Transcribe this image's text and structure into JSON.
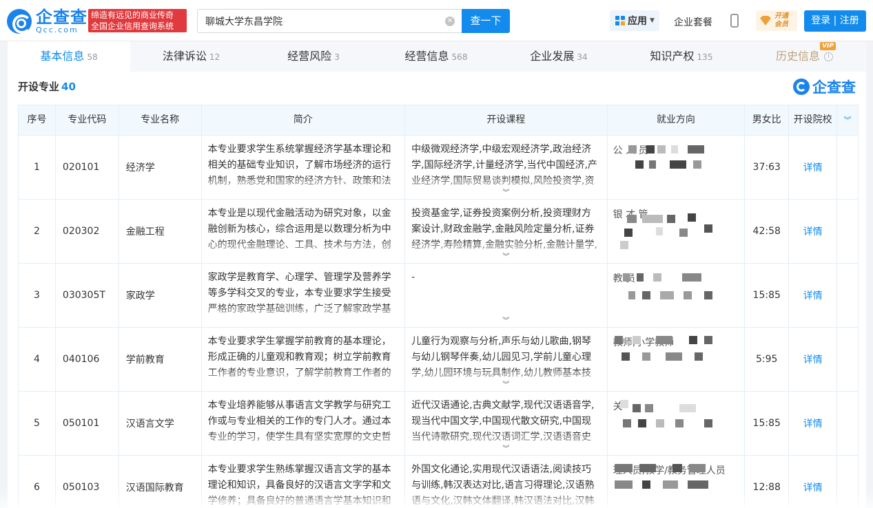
{
  "header": {
    "logo_cn": "企查查",
    "logo_en": "Qcc.com",
    "slogan_line1": "缔造有远见的商业传奇",
    "slogan_line2": "全国企业信用查询系统",
    "search_value": "聊城大学东昌学院",
    "search_button": "查一下",
    "app_label": "应用",
    "suite_label": "企业套餐",
    "vip_line1": "开通",
    "vip_line2": "会员",
    "login_label": "登录 | 注册"
  },
  "tabs": [
    {
      "label": "基本信息",
      "count": "58"
    },
    {
      "label": "法律诉讼",
      "count": "12"
    },
    {
      "label": "经营风险",
      "count": "3"
    },
    {
      "label": "经营信息",
      "count": "568"
    },
    {
      "label": "企业发展",
      "count": "34"
    },
    {
      "label": "知识产权",
      "count": "135"
    },
    {
      "label": "历史信息",
      "count": "",
      "vip": "VIP"
    }
  ],
  "section": {
    "title": "开设专业",
    "count": "40"
  },
  "watermark": "企查查",
  "table": {
    "headers": [
      "序号",
      "专业代码",
      "专业名称",
      "简介",
      "开设课程",
      "就业方向",
      "男女比",
      "开设院校"
    ],
    "rows": [
      {
        "index": "1",
        "code": "020101",
        "name": "经济学",
        "intro": "本专业要求学生系统掌握经济学基本理论和相关的基础专业知识，了解市场经济的运行机制，熟悉党和国家的经济方针、政策和法",
        "courses": "中级微观经济学,中级宏观经济学,政治经济学,国际经济学,计量经济学,当代中国经济,产业经济学,国际贸易谈判模拟,风险投资学,资",
        "career": "公 人 员",
        "ratio": "37:63",
        "detail": "详情"
      },
      {
        "index": "2",
        "code": "020302",
        "name": "金融工程",
        "intro": "本专业是以现代金融活动为研究对象，以金融创新为核心，综合运用是以数理分析为中心的现代金融理论、工具、技术与方法，创",
        "courses": "投资基金学,证券投资案例分析,投资理财方案设计,财政金融学,金融风险定量分析,证券经济学,寿险精算,金融实验分析,金融计量学,",
        "career": "银 才 管",
        "ratio": "42:58",
        "detail": "详情"
      },
      {
        "index": "3",
        "code": "030305T",
        "name": "家政学",
        "intro": "家政学是教育学、心理学、管理学及营养学等多学科交叉的专业，本专业要求学生接受严格的家政学基础训练，广泛了解家政学基",
        "courses": "-",
        "career": "教 员",
        "ratio": "15:85",
        "detail": "详情"
      },
      {
        "index": "4",
        "code": "040106",
        "name": "学前教育",
        "intro": "本专业要求学生掌握学前教育的基本理论，形成正确的儿童观和教育观；树立学前教育工作者的专业意识，了解学前教育工作者的",
        "courses": "儿童行为观察与分析,声乐与幼儿歌曲,钢琴与幼儿钢琴伴奏,幼儿园见习,学前儿童心理学,幼儿园环境与玩具制作,幼儿教师基本技",
        "career": "教师,小学教师",
        "ratio": "5:95",
        "detail": "详情"
      },
      {
        "index": "5",
        "code": "050101",
        "name": "汉语言文学",
        "intro": "本专业培养能够从事语言文学教学与研究工作或与专业相关的工作的专门人才。通过本专业的学习，使学生具有坚实宽厚的文史哲",
        "courses": "近代汉语通论,古典文献学,现代汉语语音学,现当代中国文学,中国现代散文研究,中国现当代诗歌研究,现代汉语词汇学,汉语语音史",
        "career": "关",
        "ratio": "15:85",
        "detail": "详情"
      },
      {
        "index": "6",
        "code": "050103",
        "name": "汉语国际教育",
        "intro": "本专业要求学生熟练掌握汉语言文学的基本理论和知识，具备良好的汉语言文字学和文学修养；具备良好的普通语言学基本知识和",
        "courses": "外国文化通论,实用现代汉语语法,阅读技巧与训练,韩汉表达对比,语言习得理论,汉语熟语与文化,汉韩文体翻译,韩汉语法对比,汉韩",
        "career": "理人员,教学/教务管理人员",
        "ratio": "12:88",
        "detail": "详情"
      }
    ]
  },
  "colors": {
    "accent": "#128bed",
    "slogan_bg": "#e0393e",
    "history_tab": "#bfa37a"
  }
}
